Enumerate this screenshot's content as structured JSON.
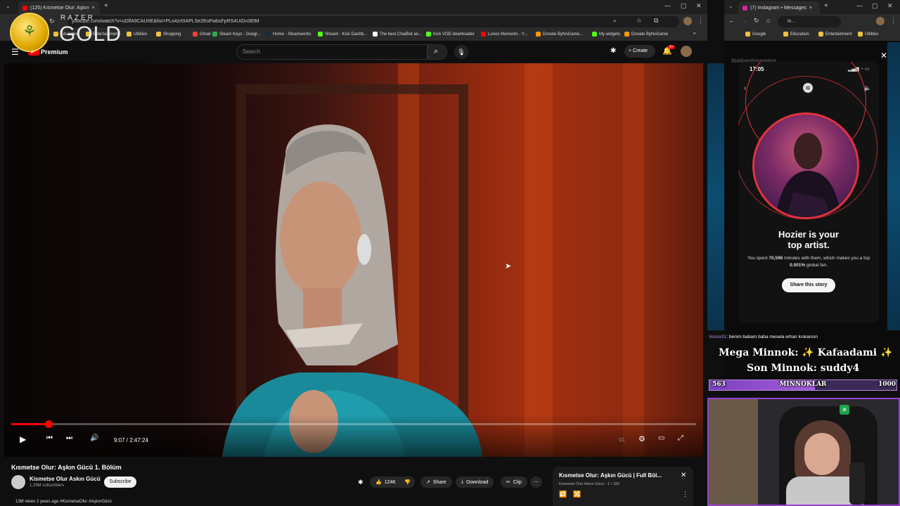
{
  "main_browser": {
    "tab_title": "(125) Kısmetse Olur: Aşkın",
    "url": "youtube.com/watch?v=uDlfA9CAUhE&list=PLo4zr0IAPLSe2EoFwbsFpRS4UIDn3EtM",
    "bookmarks": [
      {
        "label": "Education",
        "color": "#f0c040"
      },
      {
        "label": "Entertainment",
        "color": "#f0c040"
      },
      {
        "label": "Utilities",
        "color": "#f0c040"
      },
      {
        "label": "Shopping",
        "color": "#f0c040"
      },
      {
        "label": "Gmail",
        "color": "#ea4335"
      },
      {
        "label": "Steam Keys - Googl...",
        "color": "#34a853"
      },
      {
        "label": "Home - Steamworks",
        "color": "#1b2838"
      },
      {
        "label": "Stream - Kick Dashb...",
        "color": "#53fc18"
      },
      {
        "label": "The best ChatBot an...",
        "color": "#ffffff"
      },
      {
        "label": "Kick VOD downloader",
        "color": "#53fc18"
      },
      {
        "label": "Lunox Moments - Y...",
        "color": "#ff0000"
      },
      {
        "label": "Donate ByNoGame...",
        "color": "#ff9900"
      },
      {
        "label": "My widgets",
        "color": "#53fc18"
      },
      {
        "label": "Donate ByNoGame",
        "color": "#ff9900"
      }
    ],
    "yt": {
      "brand": "Premium",
      "search_placeholder": "Search",
      "create_label": "Create",
      "notif_badge": "9+"
    },
    "player": {
      "time": "9:07 / 2:47:24",
      "progress": 0.054
    },
    "video": {
      "title": "Kısmetse Olur: Aşkın Gücü 1. Bölüm",
      "channel": "Kismetse Olur Askın Gücü",
      "subscribers": "1.29M subscribers",
      "subscribe_label": "Subscribe",
      "likes": "124K",
      "share_label": "Share",
      "download_label": "Download",
      "clip_label": "Clip",
      "views_line": "13M views  2 years ago  #KismetseOlur #AşkınGücü"
    },
    "playlist": {
      "title": "Kısmetse Olur: Aşkın Gücü | Full Böl...",
      "subtitle": "Kismetse Olur Askın Gücü - 1 / 180"
    }
  },
  "razer_overlay": {
    "brand": "RAZER",
    "tier": "GOLD"
  },
  "instagram_browser": {
    "tab_title": "(7) Instagram • Messages",
    "url_fragment": "in...",
    "bookmarks": [
      "Google",
      "Education",
      "Entertainment",
      "Utilities"
    ],
    "username": "thelivestreaming",
    "story": {
      "time": "17:05",
      "headline_line1": "Hozier is your",
      "headline_line2": "top artist.",
      "body_prefix": "You spent ",
      "minutes": "70,596",
      "body_mid": " minutes with them, which makes you a top ",
      "percent": "0.001%",
      "body_suffix": " global fan.",
      "share_label": "Share this story"
    }
  },
  "stream_overlay": {
    "chat_user": "Vonox31",
    "chat_message": ": benim babam baba mesela erhan kıskansın",
    "mega_line": "Mega Minnok: ✨ Kafaadami ✨",
    "son_line": "Son Minnok: suddy4",
    "bar_left": "563",
    "bar_label": "MINNOKLAR",
    "bar_right": "1000",
    "bar_fraction": 0.563
  }
}
